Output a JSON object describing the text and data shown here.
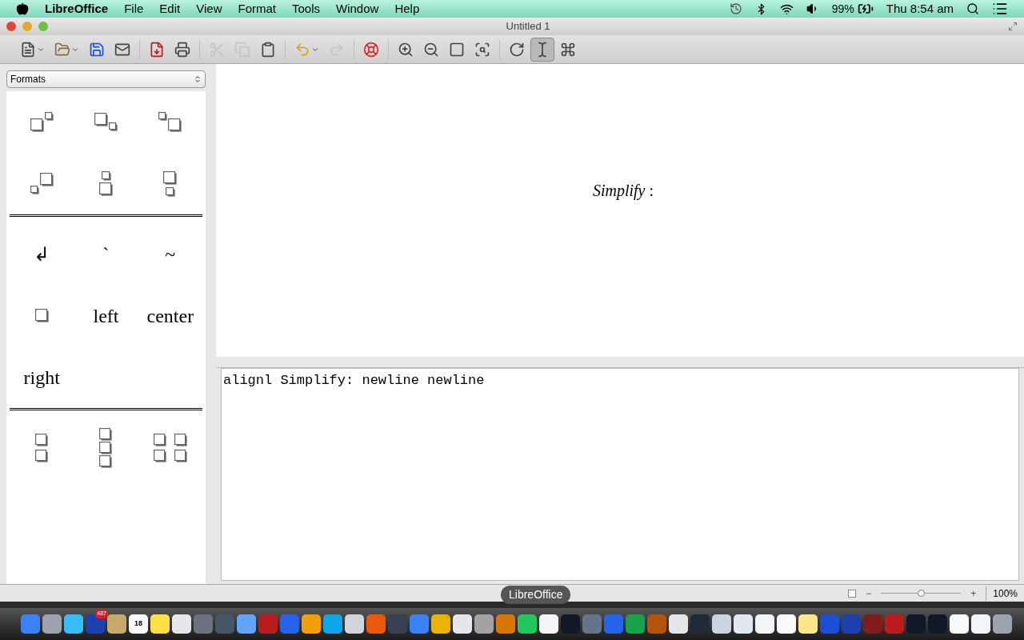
{
  "menubar": {
    "app": "LibreOffice",
    "menus": [
      "File",
      "Edit",
      "View",
      "Format",
      "Tools",
      "Window",
      "Help"
    ],
    "battery": "99%",
    "clock": "Thu 8:54 am"
  },
  "window": {
    "title": "Untitled 1"
  },
  "toolbar": [
    {
      "kind": "new",
      "dropdown": true,
      "disabled": false,
      "selected": false
    },
    {
      "kind": "open",
      "dropdown": true,
      "disabled": false,
      "selected": false
    },
    {
      "kind": "save",
      "dropdown": false,
      "disabled": false,
      "selected": false
    },
    {
      "kind": "mail",
      "dropdown": false,
      "disabled": false,
      "selected": false
    },
    {
      "kind": "sep"
    },
    {
      "kind": "pdf",
      "dropdown": false,
      "disabled": false,
      "selected": false
    },
    {
      "kind": "print",
      "dropdown": false,
      "disabled": false,
      "selected": false
    },
    {
      "kind": "sep"
    },
    {
      "kind": "cut",
      "dropdown": false,
      "disabled": true,
      "selected": false
    },
    {
      "kind": "copy",
      "dropdown": false,
      "disabled": true,
      "selected": false
    },
    {
      "kind": "paste",
      "dropdown": false,
      "disabled": false,
      "selected": false
    },
    {
      "kind": "sep"
    },
    {
      "kind": "undo",
      "dropdown": true,
      "disabled": false,
      "selected": false
    },
    {
      "kind": "redo",
      "dropdown": false,
      "disabled": true,
      "selected": false
    },
    {
      "kind": "sep"
    },
    {
      "kind": "help",
      "dropdown": false,
      "disabled": false,
      "selected": false
    },
    {
      "kind": "sep"
    },
    {
      "kind": "zoom-in",
      "dropdown": false,
      "disabled": false,
      "selected": false
    },
    {
      "kind": "zoom-out",
      "dropdown": false,
      "disabled": false,
      "selected": false
    },
    {
      "kind": "zoom-100",
      "dropdown": false,
      "disabled": false,
      "selected": false
    },
    {
      "kind": "show-all",
      "dropdown": false,
      "disabled": false,
      "selected": false
    },
    {
      "kind": "sep"
    },
    {
      "kind": "update",
      "dropdown": false,
      "disabled": false,
      "selected": false
    },
    {
      "kind": "cursor",
      "dropdown": false,
      "disabled": false,
      "selected": true
    },
    {
      "kind": "symbols",
      "dropdown": false,
      "disabled": false,
      "selected": false
    }
  ],
  "sidebar": {
    "category": "Formats",
    "groups": [
      [
        {
          "kind": "layout"
        },
        {
          "kind": "layout"
        },
        {
          "kind": "layout"
        },
        {
          "kind": "layout"
        },
        {
          "kind": "layout"
        },
        {
          "kind": "layout"
        }
      ],
      [
        {
          "kind": "text",
          "label": "↲"
        },
        {
          "kind": "text",
          "label": "`"
        },
        {
          "kind": "text",
          "label": "~"
        },
        {
          "kind": "layout"
        },
        {
          "kind": "text",
          "label": "left"
        },
        {
          "kind": "text",
          "label": "center"
        },
        {
          "kind": "text",
          "label": "right"
        }
      ],
      [
        {
          "kind": "layout"
        },
        {
          "kind": "layout"
        },
        {
          "kind": "layout"
        }
      ]
    ]
  },
  "formula_view": {
    "text": "*Simplify* :"
  },
  "command_editor": {
    "value": "alignl Simplify: newline newline"
  },
  "status_bar": {
    "tooltip": "LibreOffice",
    "zoom_out": "−",
    "zoom_in": "+",
    "zoom": {
      "level": 0.5,
      "reading": "100%"
    }
  },
  "dock": [
    {
      "color": "#3b82f6"
    },
    {
      "color": "#9ca3af"
    },
    {
      "color": "#38bdf8"
    },
    {
      "color": "#1e40af",
      "badge": "487"
    },
    {
      "color": "#c8a86a"
    },
    {
      "color": "#f8fafc",
      "label": "18"
    },
    {
      "color": "#fde047"
    },
    {
      "color": "#e5e7eb"
    },
    {
      "color": "#6b7280"
    },
    {
      "color": "#475569"
    },
    {
      "color": "#60a5fa"
    },
    {
      "color": "#b91c1c"
    },
    {
      "color": "#2563eb"
    },
    {
      "color": "#f59e0b"
    },
    {
      "color": "#0ea5e9"
    },
    {
      "color": "#d1d5db"
    },
    {
      "color": "#ea580c"
    },
    {
      "color": "#374151"
    },
    {
      "color": "#3b82f6"
    },
    {
      "color": "#eab308"
    },
    {
      "color": "#e5e7eb"
    },
    {
      "color": "#a3a3a3"
    },
    {
      "color": "#d97706"
    },
    {
      "color": "#22c55e"
    },
    {
      "color": "#f3f4f6"
    },
    {
      "color": "#111827"
    },
    {
      "color": "#64748b"
    },
    {
      "color": "#2563eb"
    },
    {
      "color": "#16a34a"
    },
    {
      "color": "#b45309"
    },
    {
      "color": "#e5e7eb"
    },
    {
      "color": "#1f2937"
    },
    {
      "color": "#cbd5e1"
    },
    {
      "color": "#e2e8f0"
    },
    {
      "color": "#f1f5f9"
    },
    {
      "color": "#f8fafc"
    },
    {
      "color": "#fde68a"
    },
    {
      "color": "#1d4ed8"
    },
    {
      "color": "#1e40af"
    },
    {
      "color": "#7f1d1d"
    },
    {
      "color": "#b91c1c"
    },
    {
      "color": "#111827"
    },
    {
      "color": "#111827"
    },
    {
      "color": "#f8fafc"
    },
    {
      "color": "#f1f5f9"
    },
    {
      "color": "#9ca3af"
    }
  ]
}
